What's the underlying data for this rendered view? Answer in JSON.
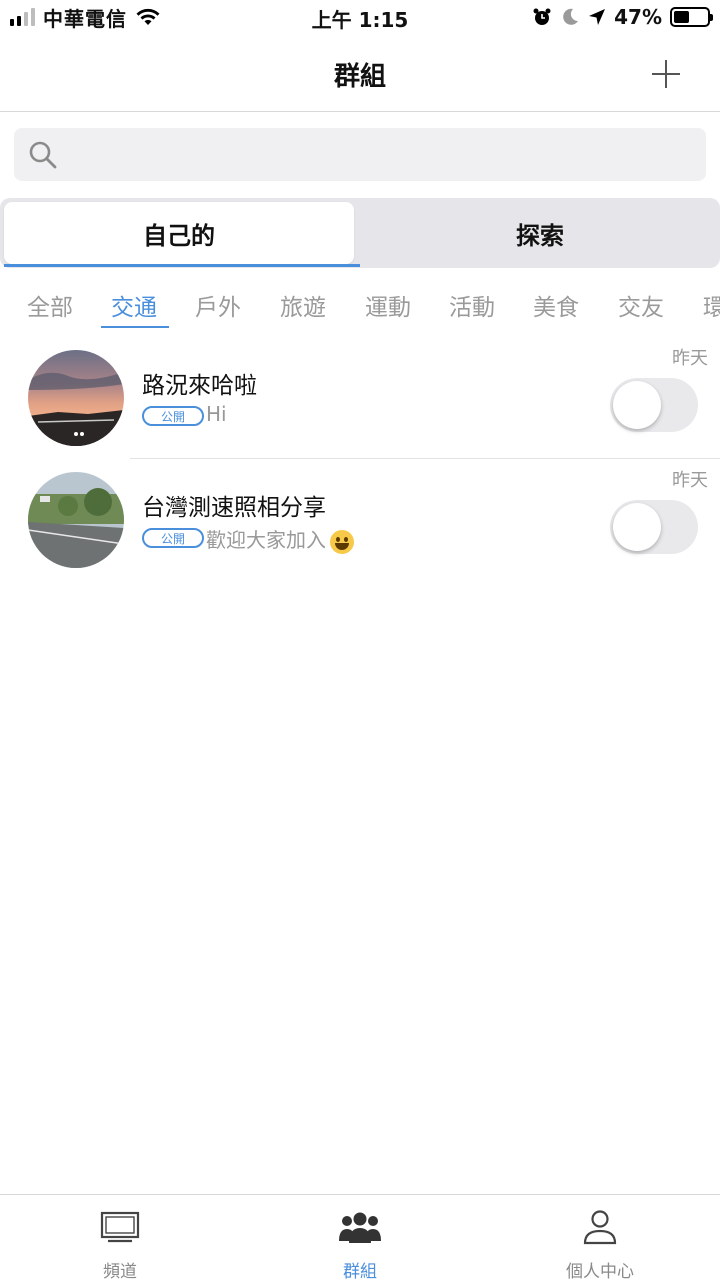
{
  "status_bar": {
    "carrier": "中華電信",
    "time": "上午 1:15",
    "battery_percent": "47%",
    "battery_level": 0.47,
    "signal_bars": 2,
    "icons": [
      "wifi-icon",
      "alarm-icon",
      "moon-icon",
      "location-arrow-icon"
    ]
  },
  "header": {
    "title": "群組",
    "add_icon": "plus-icon"
  },
  "search": {
    "placeholder": "",
    "value": "",
    "icon": "search-icon"
  },
  "segment": {
    "tabs": [
      {
        "label": "自己的",
        "selected": true
      },
      {
        "label": "探索",
        "selected": false
      }
    ]
  },
  "categories": {
    "items": [
      "全部",
      "交通",
      "戶外",
      "旅遊",
      "運動",
      "活動",
      "美食",
      "交友",
      "環"
    ],
    "selected": "交通"
  },
  "groups": [
    {
      "name": "路況來哈啦",
      "badge": "公開",
      "message": "Hi",
      "time": "昨天",
      "enabled": false
    },
    {
      "name": "台灣測速照相分享",
      "badge": "公開",
      "message": "歡迎大家加入",
      "emoji": "grinning-face-emoji",
      "time": "昨天",
      "enabled": false
    }
  ],
  "tabbar": {
    "tabs": [
      {
        "label": "頻道",
        "icon": "tv-icon",
        "active": false
      },
      {
        "label": "群組",
        "icon": "group-icon",
        "active": true
      },
      {
        "label": "個人中心",
        "icon": "person-icon",
        "active": false
      }
    ]
  },
  "colors": {
    "accent": "#4a8fdc",
    "inactive_text": "#9a9a9a",
    "segment_bg": "#e6e6ea",
    "search_bg": "#f0f0f2"
  }
}
